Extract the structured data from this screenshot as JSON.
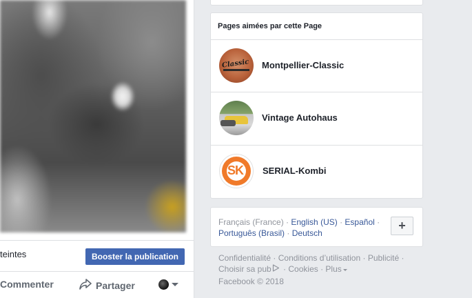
{
  "post": {
    "reach_text": "teintes",
    "boost_label": "Booster la publication",
    "actions": {
      "comment_label": "Commenter",
      "share_label": "Partager"
    }
  },
  "liked_pages": {
    "title": "Pages aimées par cette Page",
    "items": [
      {
        "name": "Montpellier-Classic",
        "logo_text": "Classic"
      },
      {
        "name": "Vintage Autohaus"
      },
      {
        "name": "SERIAL-Kombi",
        "logo_text": "SK"
      }
    ]
  },
  "languages": {
    "current": "Français (France)",
    "options": [
      "English (US)",
      "Español",
      "Português (Brasil)",
      "Deutsch"
    ],
    "more_label": "+"
  },
  "footer": {
    "links": [
      "Confidentialité",
      "Conditions d’utilisation",
      "Publicité",
      "Choisir sa pub",
      "Cookies",
      "Plus"
    ],
    "copyright": "Facebook © 2018"
  },
  "colors": {
    "accent": "#4267b2",
    "link": "#385898",
    "muted": "#90949c",
    "background": "#e9ebee"
  }
}
